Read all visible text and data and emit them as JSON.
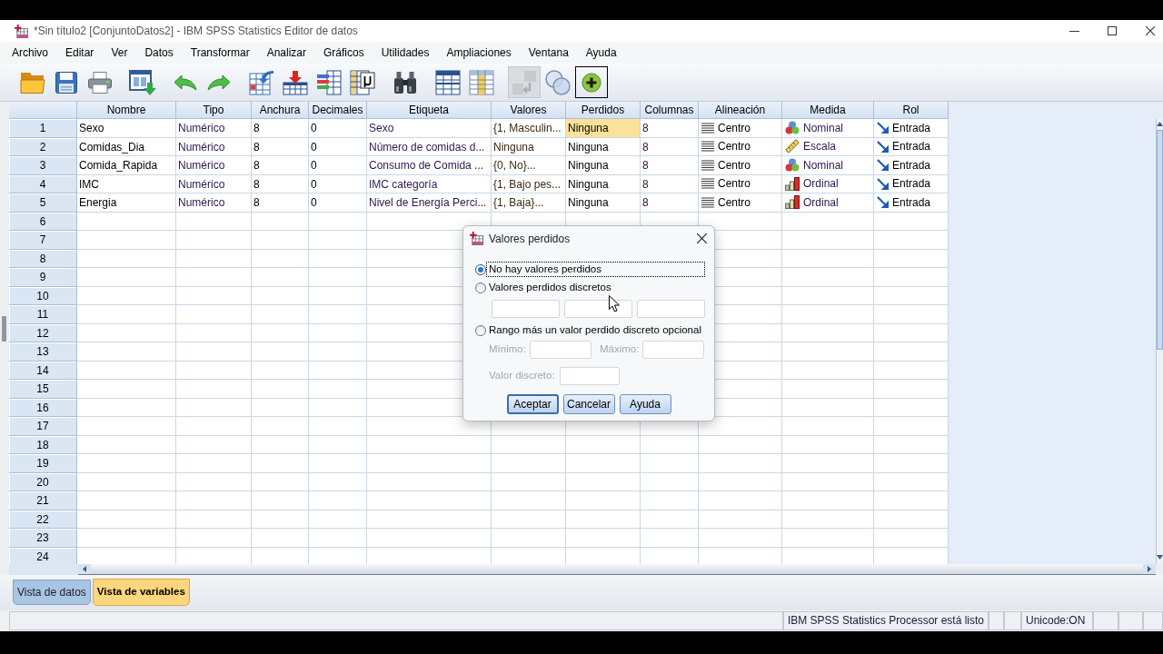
{
  "window": {
    "title": "*Sin título2 [ConjuntoDatos2] - IBM SPSS Statistics Editor de datos"
  },
  "menu": [
    "Archivo",
    "Editar",
    "Ver",
    "Datos",
    "Transformar",
    "Analizar",
    "Gráficos",
    "Utilidades",
    "Ampliaciones",
    "Ventana",
    "Ayuda"
  ],
  "toolbar": [
    [
      {
        "kind": "folder",
        "disabled": false,
        "focused": false
      },
      {
        "kind": "floppy",
        "disabled": false,
        "focused": false
      },
      {
        "kind": "printer",
        "disabled": false,
        "focused": false
      }
    ],
    [
      {
        "kind": "window_arrow",
        "disabled": false,
        "focused": false
      }
    ],
    [
      {
        "kind": "undo",
        "disabled": false,
        "focused": false
      },
      {
        "kind": "redo",
        "disabled": false,
        "focused": false
      }
    ],
    [
      {
        "kind": "table_arrow",
        "disabled": false,
        "focused": false
      },
      {
        "kind": "table_down_arrow",
        "disabled": false,
        "focused": false
      },
      {
        "kind": "bars_table",
        "disabled": false,
        "focused": false
      },
      {
        "kind": "table_symbol",
        "disabled": false,
        "focused": false
      }
    ],
    [
      {
        "kind": "binoculars",
        "disabled": false,
        "focused": false
      }
    ],
    [
      {
        "kind": "table",
        "disabled": false,
        "focused": false
      },
      {
        "kind": "table_column",
        "disabled": false,
        "focused": false
      }
    ],
    [
      {
        "kind": "boxes_arrow",
        "disabled": true,
        "focused": false
      },
      {
        "kind": "circles",
        "disabled": false,
        "focused": false
      },
      {
        "kind": "plus",
        "disabled": false,
        "focused": true
      }
    ]
  ],
  "grid": {
    "columns": [
      "Nombre",
      "Tipo",
      "Anchura",
      "Decimales",
      "Etiqueta",
      "Valores",
      "Perdidos",
      "Columnas",
      "Alineación",
      "Medida",
      "Rol"
    ],
    "rows": [
      {
        "number": "1",
        "cells": [
          {
            "kind": "text",
            "text": "Sexo",
            "selected": false
          },
          {
            "kind": "text",
            "text": "Numérico",
            "selected": false
          },
          {
            "kind": "text",
            "text": "8",
            "selected": false
          },
          {
            "kind": "text",
            "text": "0",
            "selected": false
          },
          {
            "kind": "text",
            "text": "Sexo",
            "selected": false
          },
          {
            "kind": "text",
            "text": "{1, Masculin...",
            "selected": false
          },
          {
            "kind": "text",
            "text": "Ninguna",
            "selected": true
          },
          {
            "kind": "text",
            "text": "8",
            "selected": false
          },
          {
            "kind": "align_center",
            "text": "Centro",
            "selected": false
          },
          {
            "kind": "nominal",
            "text": "Nominal",
            "selected": false
          },
          {
            "kind": "input",
            "text": "Entrada",
            "selected": false
          }
        ]
      },
      {
        "number": "2",
        "cells": [
          {
            "kind": "text",
            "text": "Comidas_Dia",
            "selected": false
          },
          {
            "kind": "text",
            "text": "Numérico",
            "selected": false
          },
          {
            "kind": "text",
            "text": "8",
            "selected": false
          },
          {
            "kind": "text",
            "text": "0",
            "selected": false
          },
          {
            "kind": "text",
            "text": "Número de comidas d...",
            "selected": false
          },
          {
            "kind": "text",
            "text": "Ninguna",
            "selected": false
          },
          {
            "kind": "text",
            "text": "Ninguna",
            "selected": false
          },
          {
            "kind": "text",
            "text": "8",
            "selected": false
          },
          {
            "kind": "align_center",
            "text": "Centro",
            "selected": false
          },
          {
            "kind": "scale",
            "text": "Escala",
            "selected": false
          },
          {
            "kind": "input",
            "text": "Entrada",
            "selected": false
          }
        ]
      },
      {
        "number": "3",
        "cells": [
          {
            "kind": "text",
            "text": "Comida_Rapida",
            "selected": false
          },
          {
            "kind": "text",
            "text": "Numérico",
            "selected": false
          },
          {
            "kind": "text",
            "text": "8",
            "selected": false
          },
          {
            "kind": "text",
            "text": "0",
            "selected": false
          },
          {
            "kind": "text",
            "text": "Consumo de Comida ...",
            "selected": false
          },
          {
            "kind": "text",
            "text": "{0, No}...",
            "selected": false
          },
          {
            "kind": "text",
            "text": "Ninguna",
            "selected": false
          },
          {
            "kind": "text",
            "text": "8",
            "selected": false
          },
          {
            "kind": "align_center",
            "text": "Centro",
            "selected": false
          },
          {
            "kind": "nominal",
            "text": "Nominal",
            "selected": false
          },
          {
            "kind": "input",
            "text": "Entrada",
            "selected": false
          }
        ]
      },
      {
        "number": "4",
        "cells": [
          {
            "kind": "text",
            "text": "IMC",
            "selected": false
          },
          {
            "kind": "text",
            "text": "Numérico",
            "selected": false
          },
          {
            "kind": "text",
            "text": "8",
            "selected": false
          },
          {
            "kind": "text",
            "text": "0",
            "selected": false
          },
          {
            "kind": "text",
            "text": "IMC categoría",
            "selected": false
          },
          {
            "kind": "text",
            "text": "{1, Bajo pes...",
            "selected": false
          },
          {
            "kind": "text",
            "text": "Ninguna",
            "selected": false
          },
          {
            "kind": "text",
            "text": "8",
            "selected": false
          },
          {
            "kind": "align_center",
            "text": "Centro",
            "selected": false
          },
          {
            "kind": "ordinal",
            "text": "Ordinal",
            "selected": false
          },
          {
            "kind": "input",
            "text": "Entrada",
            "selected": false
          }
        ]
      },
      {
        "number": "5",
        "cells": [
          {
            "kind": "text",
            "text": "Energia",
            "selected": false
          },
          {
            "kind": "text",
            "text": "Numérico",
            "selected": false
          },
          {
            "kind": "text",
            "text": "8",
            "selected": false
          },
          {
            "kind": "text",
            "text": "0",
            "selected": false
          },
          {
            "kind": "text",
            "text": "Nivel de Energía Perci...",
            "selected": false
          },
          {
            "kind": "text",
            "text": "{1, Baja}...",
            "selected": false
          },
          {
            "kind": "text",
            "text": "Ninguna",
            "selected": false
          },
          {
            "kind": "text",
            "text": "8",
            "selected": false
          },
          {
            "kind": "align_center",
            "text": "Centro",
            "selected": false
          },
          {
            "kind": "ordinal",
            "text": "Ordinal",
            "selected": false
          },
          {
            "kind": "input",
            "text": "Entrada",
            "selected": false
          }
        ]
      },
      {
        "number": "6"
      },
      {
        "number": "7"
      },
      {
        "number": "8"
      },
      {
        "number": "9"
      },
      {
        "number": "10"
      },
      {
        "number": "11"
      },
      {
        "number": "12"
      },
      {
        "number": "13"
      },
      {
        "number": "14"
      },
      {
        "number": "15"
      },
      {
        "number": "16"
      },
      {
        "number": "17"
      },
      {
        "number": "18"
      },
      {
        "number": "19"
      },
      {
        "number": "20"
      },
      {
        "number": "21"
      },
      {
        "number": "22"
      },
      {
        "number": "23"
      },
      {
        "number": "24"
      }
    ]
  },
  "dialog": {
    "title": "Valores perdidos",
    "options": [
      {
        "label": "No hay valores perdidos",
        "selected": true,
        "focused": true
      },
      {
        "label": "Valores perdidos discretos",
        "selected": false,
        "focused": false
      },
      {
        "label": "Rango más un valor perdido discreto opcional",
        "selected": false,
        "focused": false
      }
    ],
    "discrete_fields": [
      {
        "disabled": true
      },
      {
        "disabled": true
      },
      {
        "disabled": true
      }
    ],
    "range_fields": [
      {
        "label": "Mínimo:",
        "disabled": true
      },
      {
        "label": "Máximo:",
        "disabled": true
      }
    ],
    "discrete_value_field": {
      "label": "Valor discreto:",
      "disabled": true
    },
    "buttons": [
      {
        "label": "Aceptar",
        "default": true
      },
      {
        "label": "Cancelar",
        "default": false
      },
      {
        "label": "Ayuda",
        "default": false
      }
    ]
  },
  "view_tabs": [
    {
      "label": "Vista de datos",
      "selected": false
    },
    {
      "label": "Vista de variables",
      "selected": true
    }
  ],
  "status_bar": {
    "message": "IBM SPSS Statistics Processor está listo",
    "encoding": "Unicode:ON"
  }
}
